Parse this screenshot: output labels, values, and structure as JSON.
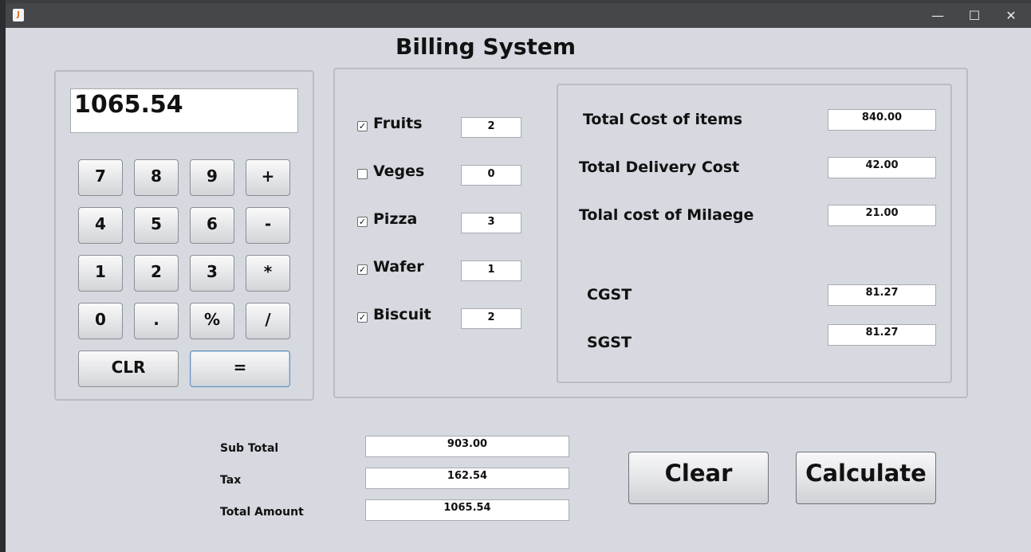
{
  "window": {
    "app_title": "Billing System",
    "icons": {
      "app": "java-icon",
      "minimize": "minimize-icon",
      "maximize": "maximize-icon",
      "close": "close-icon"
    }
  },
  "calculator": {
    "display": "1065.54",
    "keys": {
      "k7": "7",
      "k8": "8",
      "k9": "9",
      "plus": "+",
      "k4": "4",
      "k5": "5",
      "k6": "6",
      "minus": "-",
      "k1": "1",
      "k2": "2",
      "k3": "3",
      "mul": "*",
      "k0": "0",
      "dot": ".",
      "pct": "%",
      "div": "/",
      "clr": "CLR",
      "eq": "="
    }
  },
  "items": [
    {
      "label": "Fruits",
      "checked": true,
      "qty": "2"
    },
    {
      "label": "Veges",
      "checked": false,
      "qty": "0"
    },
    {
      "label": "Pizza",
      "checked": true,
      "qty": "3"
    },
    {
      "label": "Wafer",
      "checked": true,
      "qty": "1"
    },
    {
      "label": "Biscuit",
      "checked": true,
      "qty": "2"
    }
  ],
  "costs": {
    "items_label": "Total Cost of items",
    "items_value": "840.00",
    "delivery_label": "Total Delivery Cost",
    "delivery_value": "42.00",
    "mileage_label": "Tolal cost of Milaege",
    "mileage_value": "21.00",
    "cgst_label": "CGST",
    "cgst_value": "81.27",
    "sgst_label": "SGST",
    "sgst_value": "81.27"
  },
  "summary": {
    "subtotal_label": "Sub Total",
    "subtotal_value": "903.00",
    "tax_label": "Tax",
    "tax_value": "162.54",
    "total_label": "Total Amount",
    "total_value": "1065.54"
  },
  "actions": {
    "clear": "Clear",
    "calculate": "Calculate"
  }
}
